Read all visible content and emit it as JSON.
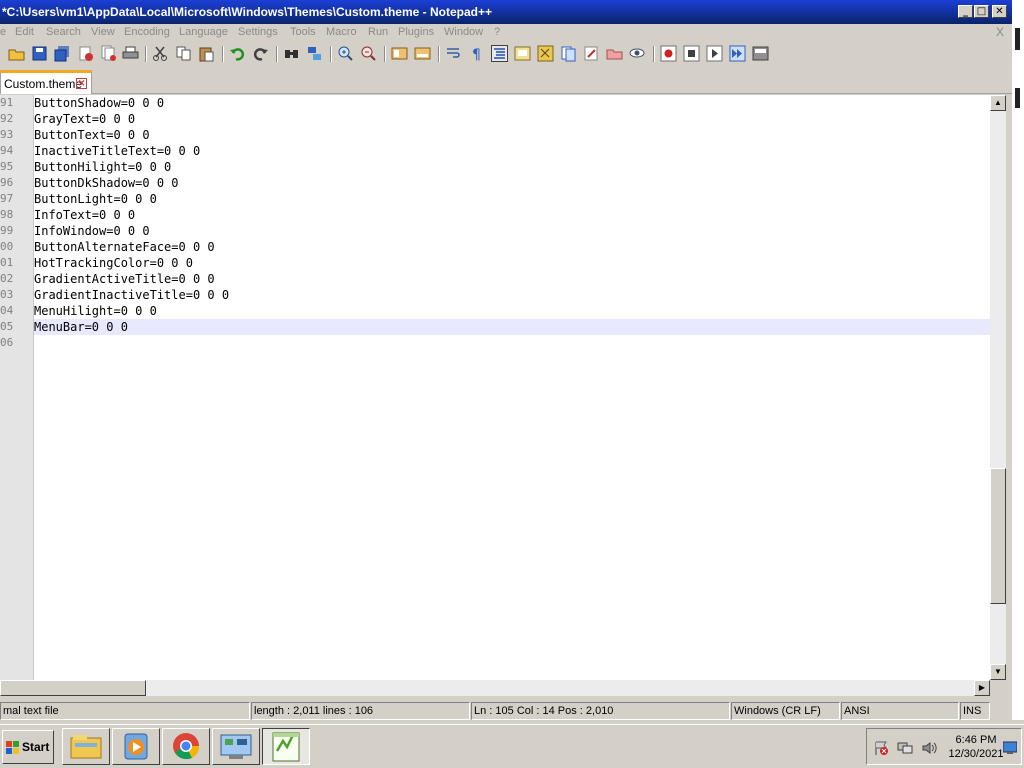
{
  "window": {
    "title": "*C:\\Users\\vm1\\AppData\\Local\\Microsoft\\Windows\\Themes\\Custom.theme - Notepad++"
  },
  "menu": {
    "items": [
      "e",
      "Edit",
      "Search",
      "View",
      "Encoding",
      "Language",
      "Settings",
      "Tools",
      "Macro",
      "Run",
      "Plugins",
      "Window",
      "?"
    ],
    "close": "X"
  },
  "tabs": [
    {
      "label": "Custom.theme",
      "active": true,
      "modified": true
    }
  ],
  "editor": {
    "lines": [
      {
        "num": "91",
        "text": "ButtonShadow=0 0 0"
      },
      {
        "num": "92",
        "text": "GrayText=0 0 0"
      },
      {
        "num": "93",
        "text": "ButtonText=0 0 0"
      },
      {
        "num": "94",
        "text": "InactiveTitleText=0 0 0"
      },
      {
        "num": "95",
        "text": "ButtonHilight=0 0 0"
      },
      {
        "num": "96",
        "text": "ButtonDkShadow=0 0 0"
      },
      {
        "num": "97",
        "text": "ButtonLight=0 0 0"
      },
      {
        "num": "98",
        "text": "InfoText=0 0 0"
      },
      {
        "num": "99",
        "text": "InfoWindow=0 0 0"
      },
      {
        "num": "00",
        "text": "ButtonAlternateFace=0 0 0"
      },
      {
        "num": "01",
        "text": "HotTrackingColor=0 0 0"
      },
      {
        "num": "02",
        "text": "GradientActiveTitle=0 0 0"
      },
      {
        "num": "03",
        "text": "GradientInactiveTitle=0 0 0"
      },
      {
        "num": "04",
        "text": "MenuHilight=0 0 0"
      },
      {
        "num": "05",
        "text": "MenuBar=0 0 0"
      },
      {
        "num": "06",
        "text": ""
      }
    ],
    "current_line_index": 14,
    "vertical_scroll_fraction": 0.82
  },
  "status": {
    "filetype": "mal text file",
    "length": "length : 2,011    lines : 106",
    "position": "Ln : 105    Col : 14    Pos : 2,010",
    "eol": "Windows (CR LF)",
    "encoding": "ANSI",
    "mode": "INS"
  },
  "taskbar": {
    "start_label": "Start",
    "apps": [
      "explorer-icon",
      "media-player-icon",
      "chrome-icon",
      "control-panel-icon",
      "notepadpp-icon"
    ],
    "clock_time": "6:46 PM",
    "clock_date": "12/30/2021"
  },
  "colors": {
    "titlebar": "#0a246a",
    "tab_accent": "#f5a623",
    "current_line": "#e8e8ff"
  }
}
